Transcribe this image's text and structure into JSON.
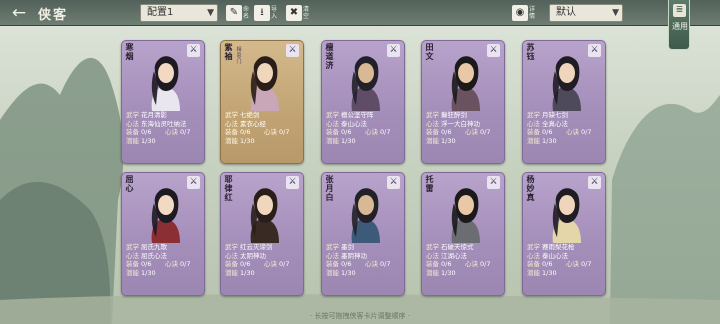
{
  "header": {
    "back_icon": "arrow-left-icon",
    "title": "侠客",
    "config_select": "配置1",
    "tools": [
      {
        "icon": "brush-icon",
        "label": "命名"
      },
      {
        "icon": "download-icon",
        "label": "导入"
      },
      {
        "icon": "trash-icon",
        "label": "清空"
      }
    ],
    "detail_toggle": {
      "icon": "eye-icon",
      "label": "详情"
    },
    "sort_select": "默认",
    "side_tab": {
      "icon": "book-icon",
      "label": "通用"
    }
  },
  "labels": {
    "wuxue": "武学",
    "xinfa": "心法",
    "zhuangbei": "装备",
    "xinjue": "心诀",
    "qianneng": "潜能"
  },
  "cards": [
    {
      "name": "寒烟",
      "title": "",
      "wuxue": "花月清影",
      "xinfa": "东海仙灵吐纳法",
      "zhuangbei": "0/6",
      "xinjue": "0/7",
      "qianneng": "1/30",
      "gold": false
    },
    {
      "name": "紫袖",
      "title": "相思门",
      "wuxue": "七绝剑",
      "xinfa": "素衣心经",
      "zhuangbei": "0/6",
      "xinjue": "0/7",
      "qianneng": "1/30",
      "gold": true
    },
    {
      "name": "檀道济",
      "title": "",
      "wuxue": "檀公坚守阵",
      "xinfa": "泰山心法",
      "zhuangbei": "0/6",
      "xinjue": "0/7",
      "qianneng": "1/30",
      "gold": false
    },
    {
      "name": "田文",
      "title": "",
      "wuxue": "癫狂醉剑",
      "xinfa": "浮一大白神功",
      "zhuangbei": "0/6",
      "xinjue": "0/7",
      "qianneng": "1/30",
      "gold": false
    },
    {
      "name": "苏钰",
      "title": "",
      "wuxue": "月缺七剑",
      "xinfa": "全真心法",
      "zhuangbei": "0/6",
      "xinjue": "0/7",
      "qianneng": "1/30",
      "gold": false
    },
    {
      "name": "屈心",
      "title": "",
      "wuxue": "屈氏九歌",
      "xinfa": "屈氏心法",
      "zhuangbei": "0/6",
      "xinjue": "0/7",
      "qianneng": "1/30",
      "gold": false
    },
    {
      "name": "耶律红",
      "title": "",
      "wuxue": "红云灭谛剑",
      "xinfa": "太阴神功",
      "zhuangbei": "0/6",
      "xinjue": "0/7",
      "qianneng": "1/30",
      "gold": false
    },
    {
      "name": "张月白",
      "title": "",
      "wuxue": "墨剑",
      "xinfa": "墨阴神功",
      "zhuangbei": "0/6",
      "xinjue": "0/7",
      "qianneng": "1/30",
      "gold": false
    },
    {
      "name": "托雷",
      "title": "",
      "wuxue": "石破天惊式",
      "xinfa": "江湖心法",
      "zhuangbei": "0/6",
      "xinjue": "0/7",
      "qianneng": "1/30",
      "gold": false
    },
    {
      "name": "杨妙真",
      "title": "",
      "wuxue": "赛雨梨花枪",
      "xinfa": "泰山心法",
      "zhuangbei": "0/6",
      "xinjue": "0/7",
      "qianneng": "1/30",
      "gold": false
    }
  ],
  "footer_hint": "· 长按可拖拽侠客卡片调整顺序 ·"
}
